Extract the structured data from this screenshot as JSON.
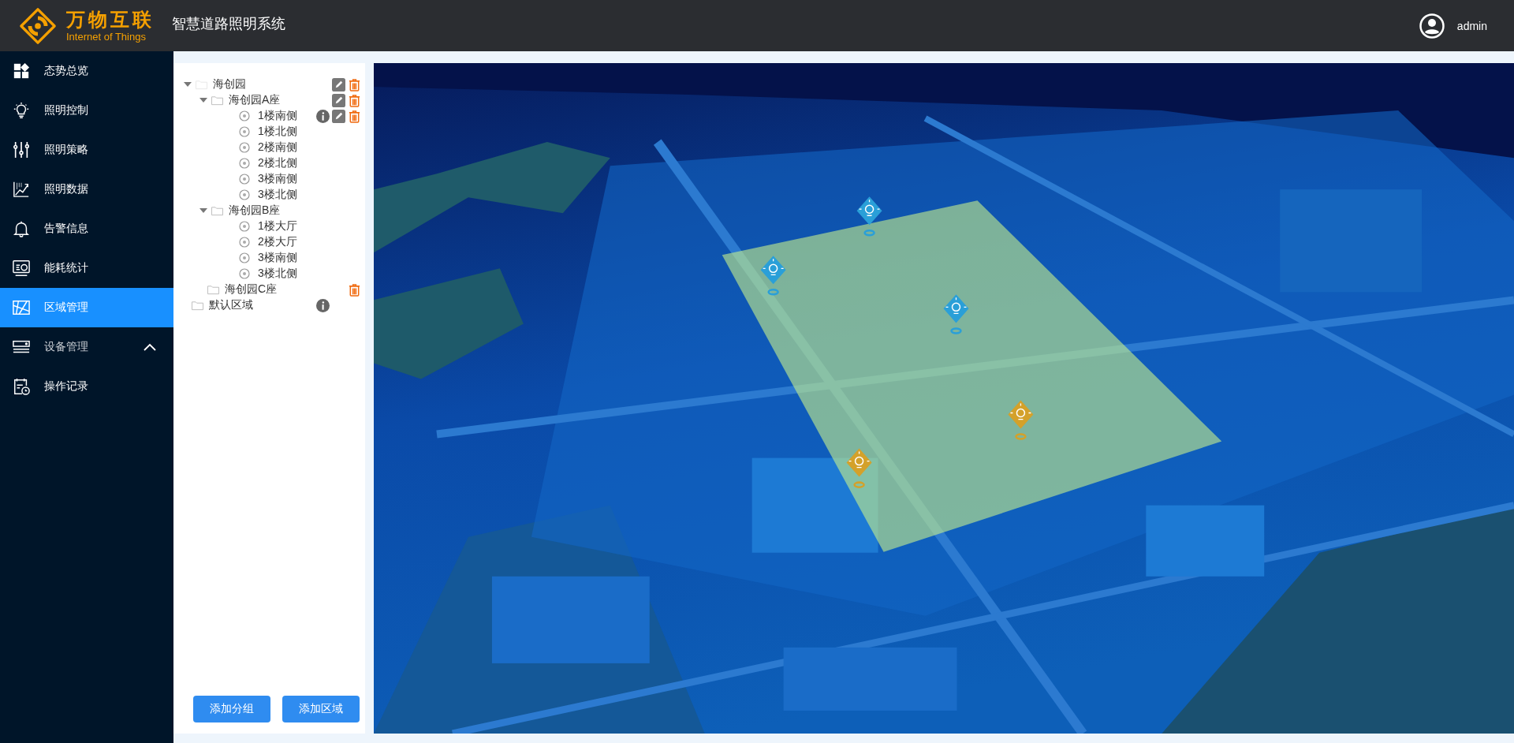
{
  "header": {
    "logo_title": "万物互联",
    "logo_subtitle": "Internet of Things",
    "app_title": "智慧道路照明系统",
    "user": "admin"
  },
  "sidebar": {
    "items": [
      {
        "label": "态势总览",
        "selected": false
      },
      {
        "label": "照明控制",
        "selected": false
      },
      {
        "label": "照明策略",
        "selected": false
      },
      {
        "label": "照明数据",
        "selected": false
      },
      {
        "label": "告警信息",
        "selected": false
      },
      {
        "label": "能耗统计",
        "selected": false
      },
      {
        "label": "区域管理",
        "selected": true
      },
      {
        "label": "设备管理",
        "selected": false,
        "expanded": true
      },
      {
        "label": "操作记录",
        "selected": false
      }
    ]
  },
  "tree": [
    {
      "kind": "folder",
      "label": "海创园",
      "expanded": true,
      "actions": [
        {
          "kind": "edit"
        },
        {
          "kind": "delete"
        }
      ],
      "children": [
        {
          "kind": "folder",
          "label": "海创园A座",
          "expanded": true,
          "actions": [
            {
              "kind": "edit"
            },
            {
              "kind": "delete"
            }
          ],
          "children": [
            {
              "kind": "point",
              "label": "1楼南侧",
              "actions": [
                {
                  "kind": "info"
                },
                {
                  "kind": "edit"
                },
                {
                  "kind": "delete"
                }
              ]
            },
            {
              "kind": "point",
              "label": "1楼北侧"
            },
            {
              "kind": "point",
              "label": "2楼南侧"
            },
            {
              "kind": "point",
              "label": "2楼北侧"
            },
            {
              "kind": "point",
              "label": "3楼南侧"
            },
            {
              "kind": "point",
              "label": "3楼北侧"
            }
          ]
        },
        {
          "kind": "folder",
          "label": "海创园B座",
          "expanded": true,
          "children": [
            {
              "kind": "point",
              "label": "1楼大厅"
            },
            {
              "kind": "point",
              "label": "2楼大厅"
            },
            {
              "kind": "point",
              "label": "3楼南侧"
            },
            {
              "kind": "point",
              "label": "3楼北侧"
            }
          ]
        },
        {
          "kind": "folder",
          "label": "海创园C座",
          "actions": [
            {
              "kind": "delete"
            }
          ]
        }
      ]
    },
    {
      "kind": "folder",
      "label": "默认区域",
      "actions": [
        {
          "kind": "info"
        }
      ]
    }
  ],
  "buttons": [
    {
      "label": "添加分组"
    },
    {
      "label": "添加区域"
    }
  ],
  "map": {
    "markers": [
      {
        "color": "#2a9fd8"
      },
      {
        "color": "#2a9fd8"
      },
      {
        "color": "#2a9fd8"
      },
      {
        "color": "#d4a12a"
      },
      {
        "color": "#d4a12a"
      }
    ]
  }
}
